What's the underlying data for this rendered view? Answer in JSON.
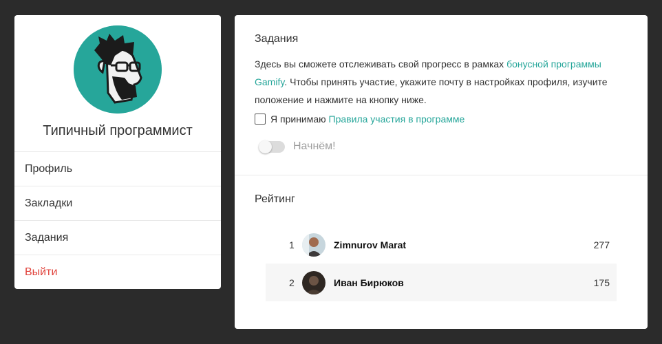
{
  "profile": {
    "name": "Типичный программист",
    "menu": [
      {
        "label": "Профиль"
      },
      {
        "label": "Закладки"
      },
      {
        "label": "Задания"
      },
      {
        "label": "Выйти"
      }
    ]
  },
  "tasks": {
    "title": "Задания",
    "description": {
      "part1": "Здесь вы сможете отслеживать свой прогресс в рамках ",
      "link": "бонусной программы Gamify",
      "part2": ". Чтобы принять участие, укажите почту в настройках профиля, изучите положение и нажмите на кнопку ниже."
    },
    "agree": {
      "text": "Я принимаю ",
      "link": "Правила участия в программе",
      "checked": false
    },
    "start_toggle": {
      "label": "Начнём!",
      "on": false
    }
  },
  "rating": {
    "title": "Рейтинг",
    "rows": [
      {
        "rank": "1",
        "name": "Zimnurov Marat",
        "score": "277"
      },
      {
        "rank": "2",
        "name": "Иван Бирюков",
        "score": "175"
      }
    ]
  },
  "colors": {
    "accent": "#26a69a",
    "logout": "#e0413a",
    "background": "#2b2b2b"
  }
}
